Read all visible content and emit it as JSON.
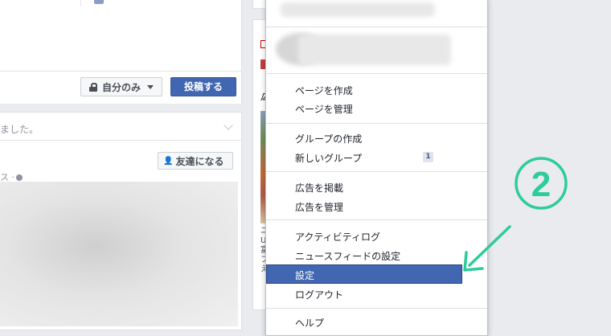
{
  "composer": {
    "privacy_label": "自分のみ",
    "post_label": "投稿する"
  },
  "story": {
    "header_fragment": "ました。",
    "add_friend_label": "友達になる",
    "meta_fragment": "ス ·"
  },
  "sidebar": {
    "ad_label_fragment": "広",
    "ad_text_fragments": [
      "ユ",
      "U",
      "富",
      "フ",
      "え"
    ]
  },
  "menu": {
    "items": [
      {
        "label": "ページを作成"
      },
      {
        "label": "ページを管理"
      },
      {
        "label": "グループの作成"
      },
      {
        "label": "新しいグループ",
        "badge": "1"
      },
      {
        "label": "広告を掲載"
      },
      {
        "label": "広告を管理"
      },
      {
        "label": "アクティビティログ"
      },
      {
        "label": "ニュースフィードの設定"
      },
      {
        "label": "設定",
        "selected": true
      },
      {
        "label": "ログアウト"
      },
      {
        "label": "ヘルプ"
      }
    ]
  },
  "annotation": {
    "step_number": "2",
    "color": "#2ecc9a"
  },
  "colors": {
    "accent": "#4267b2",
    "page_bg": "#e9ebee"
  }
}
